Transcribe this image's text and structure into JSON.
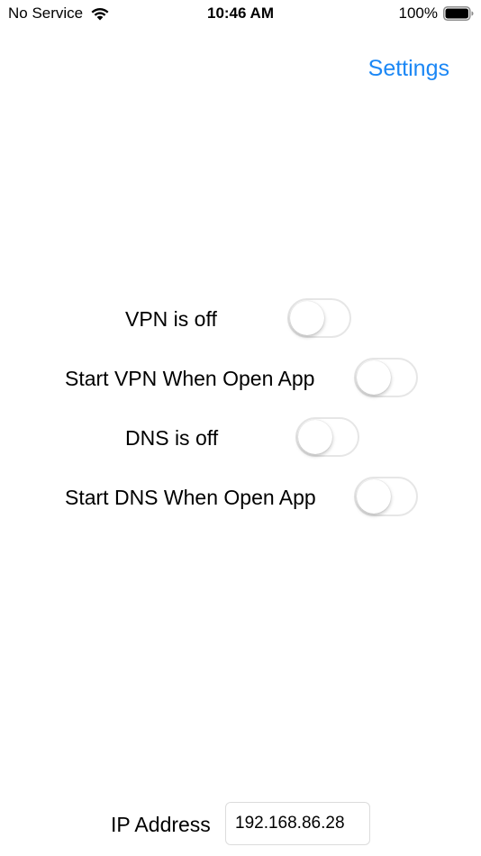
{
  "status_bar": {
    "carrier": "No Service",
    "time": "10:46 AM",
    "battery_percent": "100%",
    "battery_level": 1.0,
    "wifi_icon": "wifi-icon",
    "battery_icon": "battery-icon"
  },
  "nav": {
    "settings_label": "Settings",
    "accent_color": "#1b87f5"
  },
  "toggles": [
    {
      "label": "VPN is off",
      "on": false
    },
    {
      "label": "Start VPN When Open App",
      "on": false
    },
    {
      "label": "DNS is off",
      "on": false
    },
    {
      "label": "Start DNS When Open App",
      "on": false
    }
  ],
  "ip": {
    "label": "IP Address",
    "value": "192.168.86.28"
  }
}
